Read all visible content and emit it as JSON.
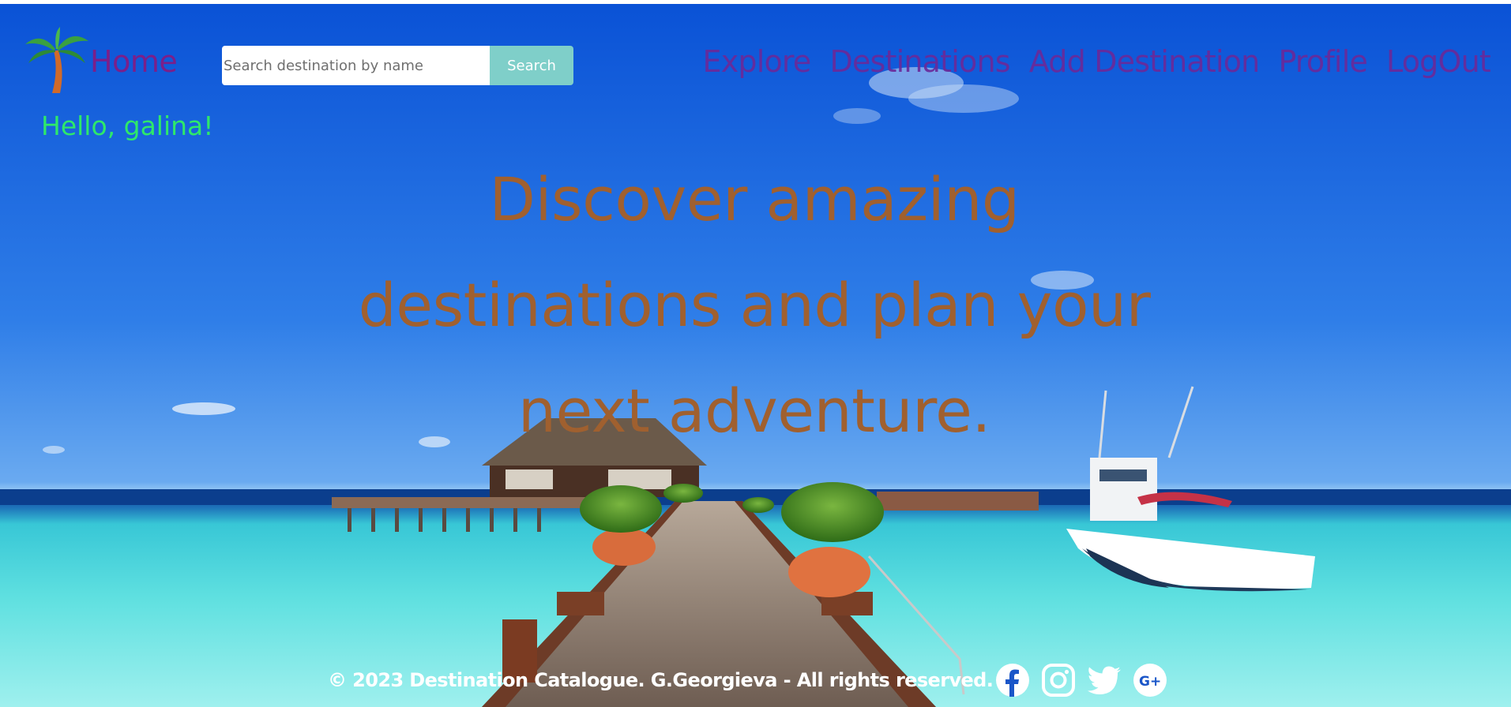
{
  "header": {
    "home_label": "Home",
    "search": {
      "placeholder": "Search destination by name",
      "value": "",
      "button_label": "Search"
    },
    "nav": [
      {
        "label": "Explore"
      },
      {
        "label": "Destinations"
      },
      {
        "label": "Add Destination"
      },
      {
        "label": "Profile"
      },
      {
        "label": "LogOut"
      }
    ],
    "greeting": "Hello, galina!"
  },
  "hero": {
    "headline_line1": "Discover amazing",
    "headline_line2": "destinations and plan your",
    "headline_line3": "next adventure.",
    "background": "tropical-beach-pier-photo"
  },
  "footer": {
    "copyright": "© 2023 Destination Catalogue. G.Georgieva - All rights reserved.",
    "social_icons": [
      "facebook-icon",
      "instagram-icon",
      "twitter-icon",
      "google-plus-icon"
    ]
  },
  "colors": {
    "nav_link": "#6a2a9a",
    "home_link": "#7b1f8a",
    "greeting": "#2ee86a",
    "headline": "#a0602f",
    "search_button": "#7fcfc9",
    "footer_text": "#ffffff"
  }
}
